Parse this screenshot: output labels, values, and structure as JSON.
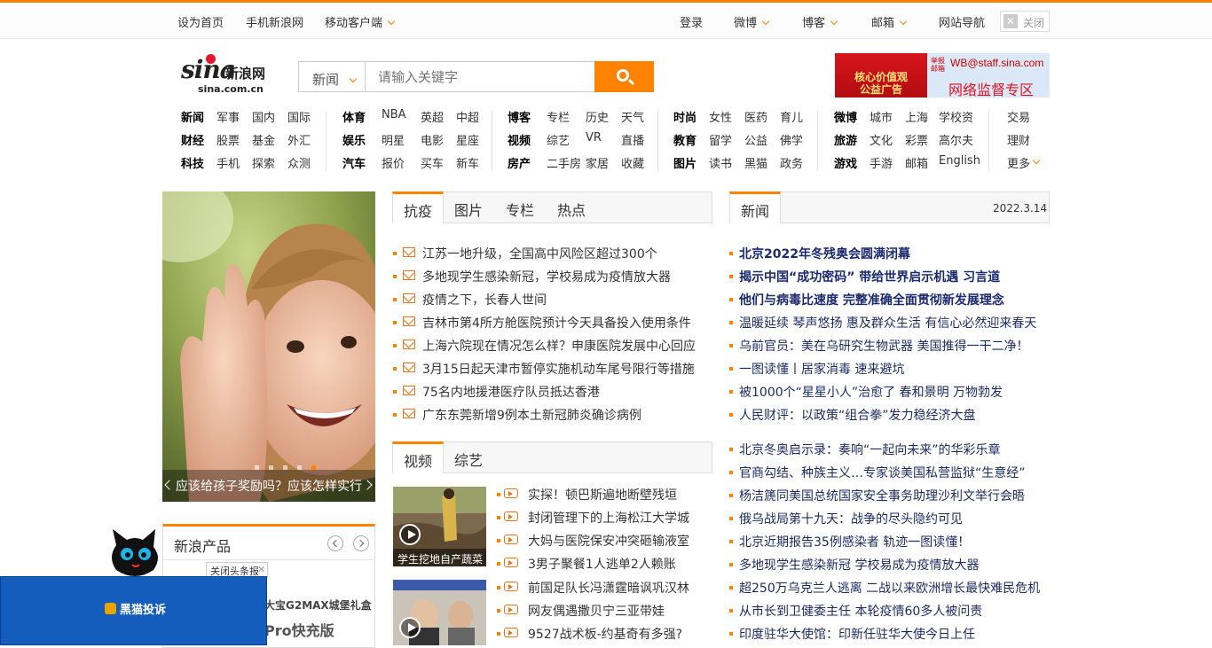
{
  "topbar": {
    "set_home": "设为首页",
    "mobile_sina": "手机新浪网",
    "mobile_client": "移动客户端",
    "login": "登录",
    "weibo": "微博",
    "blog": "博客",
    "mail": "邮箱",
    "site_nav": "网站导航",
    "close": "关闭"
  },
  "logo": {
    "main": "sina",
    "cn": "新浪网",
    "domain": "sina.com.cn"
  },
  "search": {
    "category": "新闻",
    "placeholder": "请输入关键字"
  },
  "banner": {
    "left": "核心价值观\n公益广告",
    "email": "WB@staff.sina.com",
    "tip": "举报邮箱",
    "right": "网络监督专区"
  },
  "nav": {
    "g1": [
      [
        "新闻",
        "军事",
        "国内",
        "国际"
      ],
      [
        "财经",
        "股票",
        "基金",
        "外汇"
      ],
      [
        "科技",
        "手机",
        "探索",
        "众测"
      ]
    ],
    "g2": [
      [
        "体育",
        "NBA",
        "英超",
        "中超"
      ],
      [
        "娱乐",
        "明星",
        "电影",
        "星座"
      ],
      [
        "汽车",
        "报价",
        "买车",
        "新车"
      ]
    ],
    "g3": [
      [
        "博客",
        "专栏",
        "历史",
        "天气"
      ],
      [
        "视频",
        "综艺",
        "VR",
        "直播"
      ],
      [
        "房产",
        "二手房",
        "家居",
        "收藏"
      ]
    ],
    "g4": [
      [
        "时尚",
        "女性",
        "医药",
        "育儿"
      ],
      [
        "教育",
        "留学",
        "公益",
        "佛学"
      ],
      [
        "图片",
        "读书",
        "黑猫",
        "政务"
      ]
    ],
    "g5": [
      [
        "微博",
        "城市",
        "上海",
        "学校资"
      ],
      [
        "旅游",
        "文化",
        "彩票",
        "高尔夫"
      ],
      [
        "游戏",
        "手游",
        "邮箱",
        "English"
      ]
    ],
    "g6": [
      [
        "交易"
      ],
      [
        "理财"
      ],
      [
        "更多"
      ]
    ]
  },
  "slider": {
    "caption": "应该给孩子奖励吗？应该怎样实行"
  },
  "products": {
    "title": "新浪产品",
    "line1": "大宝G2MAX城堡礼盒",
    "line2": "Pro快充版"
  },
  "close_headline": "关闭头条报",
  "ad": {
    "text": "黑猫投诉"
  },
  "tabs1": [
    "抗疫",
    "图片",
    "专栏",
    "热点"
  ],
  "list1": [
    "江苏一地升级，全国高中风险区超过300个",
    "多地现学生感染新冠，学校易成为疫情放大器",
    "疫情之下，长春人世间",
    "吉林市第4所方舱医院预计今天具备投入使用条件",
    "上海六院现在情况怎么样？申康医院发展中心回应",
    "3月15日起天津市暂停实施机动车尾号限行等措施",
    "75名内地援港医疗队员抵达香港",
    "广东东莞新增9例本土新冠肺炎确诊病例"
  ],
  "tabs2": [
    "视频",
    "综艺"
  ],
  "thumb1": "学生挖地自产蔬菜",
  "list2": [
    "实探！顿巴斯遍地断壁残垣",
    "封闭管理下的上海松江大学城",
    "大妈与医院保安冲突砸输液室",
    "3男子聚餐1人逃单2人赖账",
    "前国足队长冯潇霆暗讽巩汉林",
    "网友偶遇撒贝宁三亚带娃",
    "9527战术板-约基奇有多强?"
  ],
  "news_tab": "新闻",
  "news_date": "2022.3.14",
  "news_bold": [
    "北京2022年冬残奥会圆满闭幕",
    "揭示中国“成功密码” 带给世界启示机遇 习言道",
    "他们与病毒比速度 完整准确全面贯彻新发展理念"
  ],
  "news1": [
    "温暖延续 琴声悠扬 惠及群众生活 有信心必然迎来春天",
    "乌前官员：美在乌研究生物武器 美国推得一干二净！",
    "一图读懂丨居家消毒 速来避坑",
    "被1000个“星星小人”治愈了 春和景明 万物勃发",
    "人民财评：以政策“组合拳”发力稳经济大盘"
  ],
  "news2": [
    "北京冬奥启示录：奏响“一起向未来”的华彩乐章",
    "官商勾结、种族主义…专家谈美国私营监狱“生意经”",
    "杨洁篪同美国总统国家安全事务助理沙利文举行会晤",
    "俄乌战局第十九天：战争的尽头隐约可见",
    "北京近期报告35例感染者 轨迹一图读懂！",
    "多地现学生感染新冠 学校易成为疫情放大器",
    "超250万乌克兰人逃离 二战以来欧洲增长最快难民危机",
    "从市长到卫健委主任 本轮疫情60多人被问责",
    "印度驻华大使馆：印新任驻华大使今日上任"
  ],
  "colors": {
    "accent": "#ff8200",
    "link_dark": "#1a2a6e"
  }
}
